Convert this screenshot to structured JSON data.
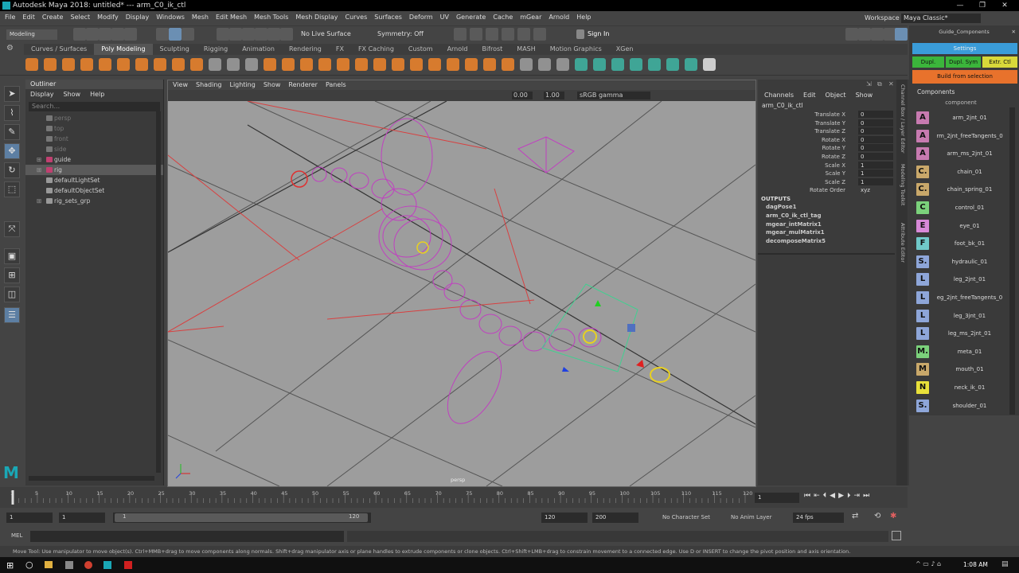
{
  "window": {
    "title": "Autodesk Maya 2018: untitled*   ---   arm_C0_ik_ctl"
  },
  "menubar": [
    "File",
    "Edit",
    "Create",
    "Select",
    "Modify",
    "Display",
    "Windows",
    "Mesh",
    "Edit Mesh",
    "Mesh Tools",
    "Mesh Display",
    "Curves",
    "Surfaces",
    "Deform",
    "UV",
    "Generate",
    "Cache",
    "mGear",
    "Arnold",
    "Help"
  ],
  "workspace": {
    "label": "Workspace :",
    "value": "Maya Classic*"
  },
  "status": {
    "mode": "Modeling",
    "live_surface": "No Live Surface",
    "symmetry": "Symmetry: Off",
    "sign_in": "Sign In"
  },
  "shelf_tabs": [
    "Curves / Surfaces",
    "Poly Modeling",
    "Sculpting",
    "Rigging",
    "Animation",
    "Rendering",
    "FX",
    "FX Caching",
    "Custom",
    "Arnold",
    "Bifrost",
    "MASH",
    "Motion Graphics",
    "XGen"
  ],
  "outliner": {
    "title": "Outliner",
    "menu": [
      "Display",
      "Show",
      "Help"
    ],
    "search_placeholder": "Search...",
    "items": [
      {
        "label": "persp",
        "dim": true
      },
      {
        "label": "top",
        "dim": true
      },
      {
        "label": "front",
        "dim": true
      },
      {
        "label": "side",
        "dim": true
      },
      {
        "label": "guide",
        "dim": false
      },
      {
        "label": "rig",
        "dim": false
      },
      {
        "label": "defaultLightSet",
        "dim": false
      },
      {
        "label": "defaultObjectSet",
        "dim": false
      },
      {
        "label": "rig_sets_grp",
        "dim": false
      }
    ]
  },
  "viewport": {
    "menu": [
      "View",
      "Shading",
      "Lighting",
      "Show",
      "Renderer",
      "Panels"
    ],
    "exposure": "0.00",
    "gamma": "1.00",
    "color_space": "sRGB gamma",
    "camera": "persp"
  },
  "channel_box": {
    "menu": [
      "Channels",
      "Edit",
      "Object",
      "Show"
    ],
    "object": "arm_C0_ik_ctl",
    "attributes": [
      {
        "name": "Translate X",
        "value": "0"
      },
      {
        "name": "Translate Y",
        "value": "0"
      },
      {
        "name": "Translate Z",
        "value": "0"
      },
      {
        "name": "Rotate X",
        "value": "0"
      },
      {
        "name": "Rotate Y",
        "value": "0"
      },
      {
        "name": "Rotate Z",
        "value": "0"
      },
      {
        "name": "Scale X",
        "value": "1"
      },
      {
        "name": "Scale Y",
        "value": "1"
      },
      {
        "name": "Scale Z",
        "value": "1"
      },
      {
        "name": "Rotate Order",
        "value": "xyz"
      }
    ],
    "outputs_title": "OUTPUTS",
    "outputs": [
      "dagPose1",
      "arm_C0_ik_ctl_tag",
      "mgear_intMatrix1",
      "mgear_mulMatrix1",
      "decomposeMatrix5"
    ]
  },
  "guide_panel": {
    "tab": "Guide_Components",
    "settings": "Settings",
    "buttons": [
      "Dupl.",
      "Dupl. Sym",
      "Extr. Ctl"
    ],
    "build": "Build from selection",
    "components_title": "Components",
    "column": "component",
    "components": [
      {
        "letter": "A",
        "name": "arm_2jnt_01",
        "color": "#c77ab0"
      },
      {
        "letter": "A",
        "name": "rm_2jnt_freeTangents_0",
        "color": "#c77ab0"
      },
      {
        "letter": "A",
        "name": "arm_ms_2jnt_01",
        "color": "#c77ab0"
      },
      {
        "letter": "C.",
        "name": "chain_01",
        "color": "#c9a86a"
      },
      {
        "letter": "C.",
        "name": "chain_spring_01",
        "color": "#c9a86a"
      },
      {
        "letter": "C",
        "name": "control_01",
        "color": "#7bd17b"
      },
      {
        "letter": "E",
        "name": "eye_01",
        "color": "#d889d8"
      },
      {
        "letter": "F",
        "name": "foot_bk_01",
        "color": "#70c9c9"
      },
      {
        "letter": "S.",
        "name": "hydraulic_01",
        "color": "#8ea6d9"
      },
      {
        "letter": "L",
        "name": "leg_2jnt_01",
        "color": "#8ea6d9"
      },
      {
        "letter": "L",
        "name": "eg_2jnt_freeTangents_0",
        "color": "#8ea6d9"
      },
      {
        "letter": "L",
        "name": "leg_3jnt_01",
        "color": "#8ea6d9"
      },
      {
        "letter": "L",
        "name": "leg_ms_2jnt_01",
        "color": "#8ea6d9"
      },
      {
        "letter": "M.",
        "name": "meta_01",
        "color": "#7bd17b"
      },
      {
        "letter": "M",
        "name": "mouth_01",
        "color": "#c9a86a"
      },
      {
        "letter": "N",
        "name": "neck_ik_01",
        "color": "#e8e03a"
      },
      {
        "letter": "S.",
        "name": "shoulder_01",
        "color": "#8ea6d9"
      }
    ]
  },
  "timeline": {
    "ticks": [
      "1",
      "5",
      "10",
      "15",
      "20",
      "25",
      "30",
      "35",
      "40",
      "45",
      "50",
      "55",
      "60",
      "65",
      "70",
      "75",
      "80",
      "85",
      "90",
      "95",
      "100",
      "105",
      "110",
      "115",
      "120"
    ],
    "current_frame": "1"
  },
  "range": {
    "start": "1",
    "playback_start": "1",
    "slider_start": "1",
    "slider_end": "120",
    "playback_end": "120",
    "end": "200",
    "character_set": "No Character Set",
    "anim_layer": "No Anim Layer",
    "fps": "24 fps"
  },
  "command": {
    "label": "MEL"
  },
  "help_text": "Move Tool: Use manipulator to move object(s). Ctrl+MMB+drag to move components along normals. Shift+drag manipulator axis or plane handles to extrude components or clone objects. Ctrl+Shift+LMB+drag to constrain movement to a connected edge. Use D or INSERT to change the pivot position and axis orientation.",
  "taskbar": {
    "time": "1:08 AM"
  },
  "side_tabs": [
    "Channel Box / Layer Editor",
    "Modeling Toolkit",
    "Attribute Editor"
  ]
}
